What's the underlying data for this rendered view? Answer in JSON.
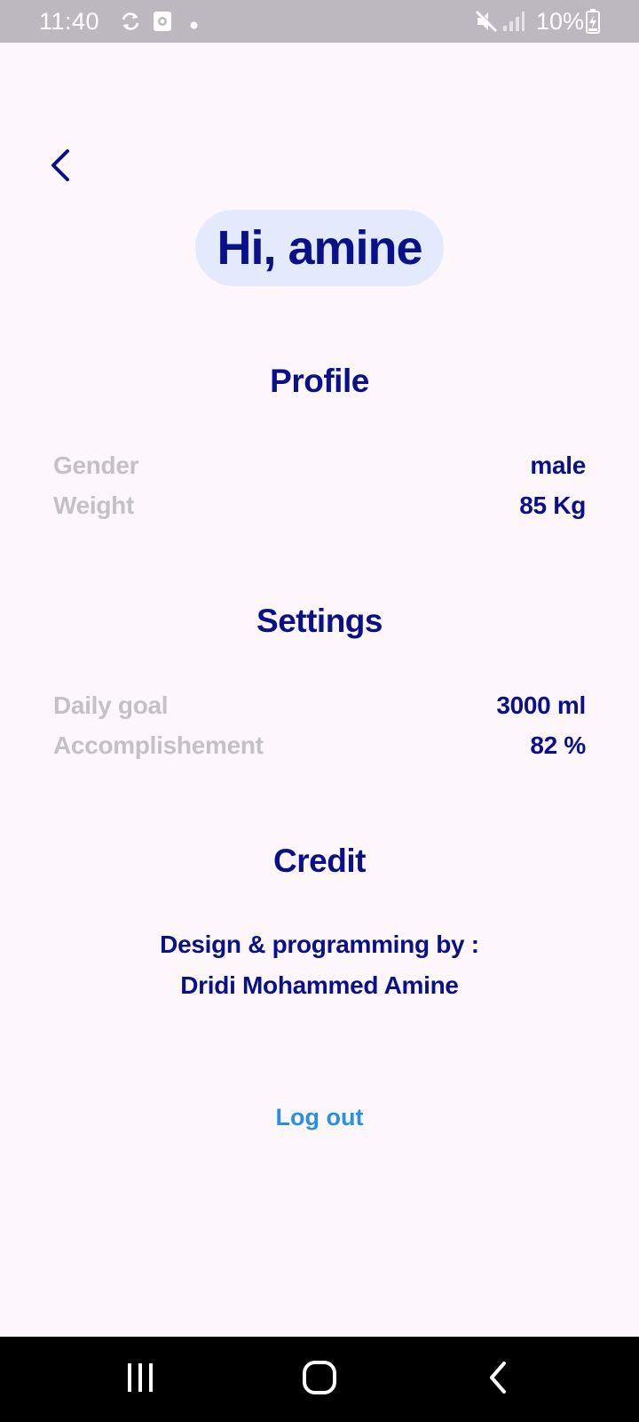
{
  "status_bar": {
    "time": "11:40",
    "battery": "10%",
    "icons": [
      "sync-icon",
      "screen-record-icon",
      "notification-dot-icon",
      "mute-icon",
      "signal-icon",
      "battery-charging-icon"
    ]
  },
  "header": {
    "back_icon": "chevron-left-icon",
    "greeting": "Hi, amine"
  },
  "profile": {
    "title": "Profile",
    "rows": [
      {
        "label": "Gender",
        "value": "male"
      },
      {
        "label": "Weight",
        "value": "85 Kg"
      }
    ]
  },
  "settings": {
    "title": "Settings",
    "rows": [
      {
        "label": "Daily goal",
        "value": "3000 ml"
      },
      {
        "label": "Accomplishement",
        "value": "82 %"
      }
    ]
  },
  "credit": {
    "title": "Credit",
    "line1": "Design & programming by :",
    "line2": "Dridi Mohammed Amine"
  },
  "actions": {
    "logout": "Log out"
  },
  "nav_bar": {
    "buttons": [
      "recent-apps-icon",
      "home-icon",
      "back-icon"
    ]
  },
  "colors": {
    "primary": "#0a0f8a",
    "muted": "#c3c1c6",
    "link": "#2a8fe0",
    "pill": "#e3eafb",
    "background": "#fdf7fc"
  }
}
